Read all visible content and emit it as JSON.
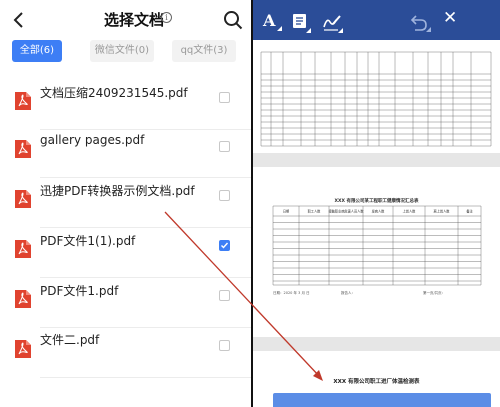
{
  "left": {
    "title": "选择文档",
    "info_symbol": "i",
    "tabs": [
      {
        "label": "全部(6)",
        "active": true
      },
      {
        "label": "微信文件(0)",
        "active": false
      },
      {
        "label": "qq文件(3)",
        "active": false
      }
    ],
    "files": [
      {
        "name": "文档压缩2409231545.pdf",
        "checked": false
      },
      {
        "name": "gallery pages.pdf",
        "checked": false
      },
      {
        "name": "迅捷PDF转换器示例文档.pdf",
        "checked": false
      },
      {
        "name": "PDF文件1(1).pdf",
        "checked": true
      },
      {
        "name": "PDF文件1.pdf",
        "checked": false
      },
      {
        "name": "文件二.pdf",
        "checked": false
      }
    ]
  },
  "right": {
    "toolbar": {
      "icons": [
        "text-icon",
        "note-icon",
        "signature-icon",
        "undo-icon",
        "close-icon"
      ],
      "text_glyph": "A",
      "close_glyph": "✕"
    },
    "page2": {
      "title": "XXX 有限公司某工程职工健康情况汇总表",
      "headers": [
        "日期",
        "职工人数",
        "接触职业病危害人员人数",
        "发病人数",
        "上岗人数",
        "离上岗人数",
        "备注"
      ],
      "footer_left": "日期：2020 年 3 月 日",
      "footer_mid": "报告人：",
      "footer_right": "第一页/共页："
    },
    "page3": {
      "title": "XXX 有限公司职工进厂体温检测表"
    }
  },
  "colors": {
    "accent": "#3d7ef5",
    "toolbar": "#2b4d98",
    "pdf_red": "#e0432f",
    "arrow": "#c0392b"
  }
}
